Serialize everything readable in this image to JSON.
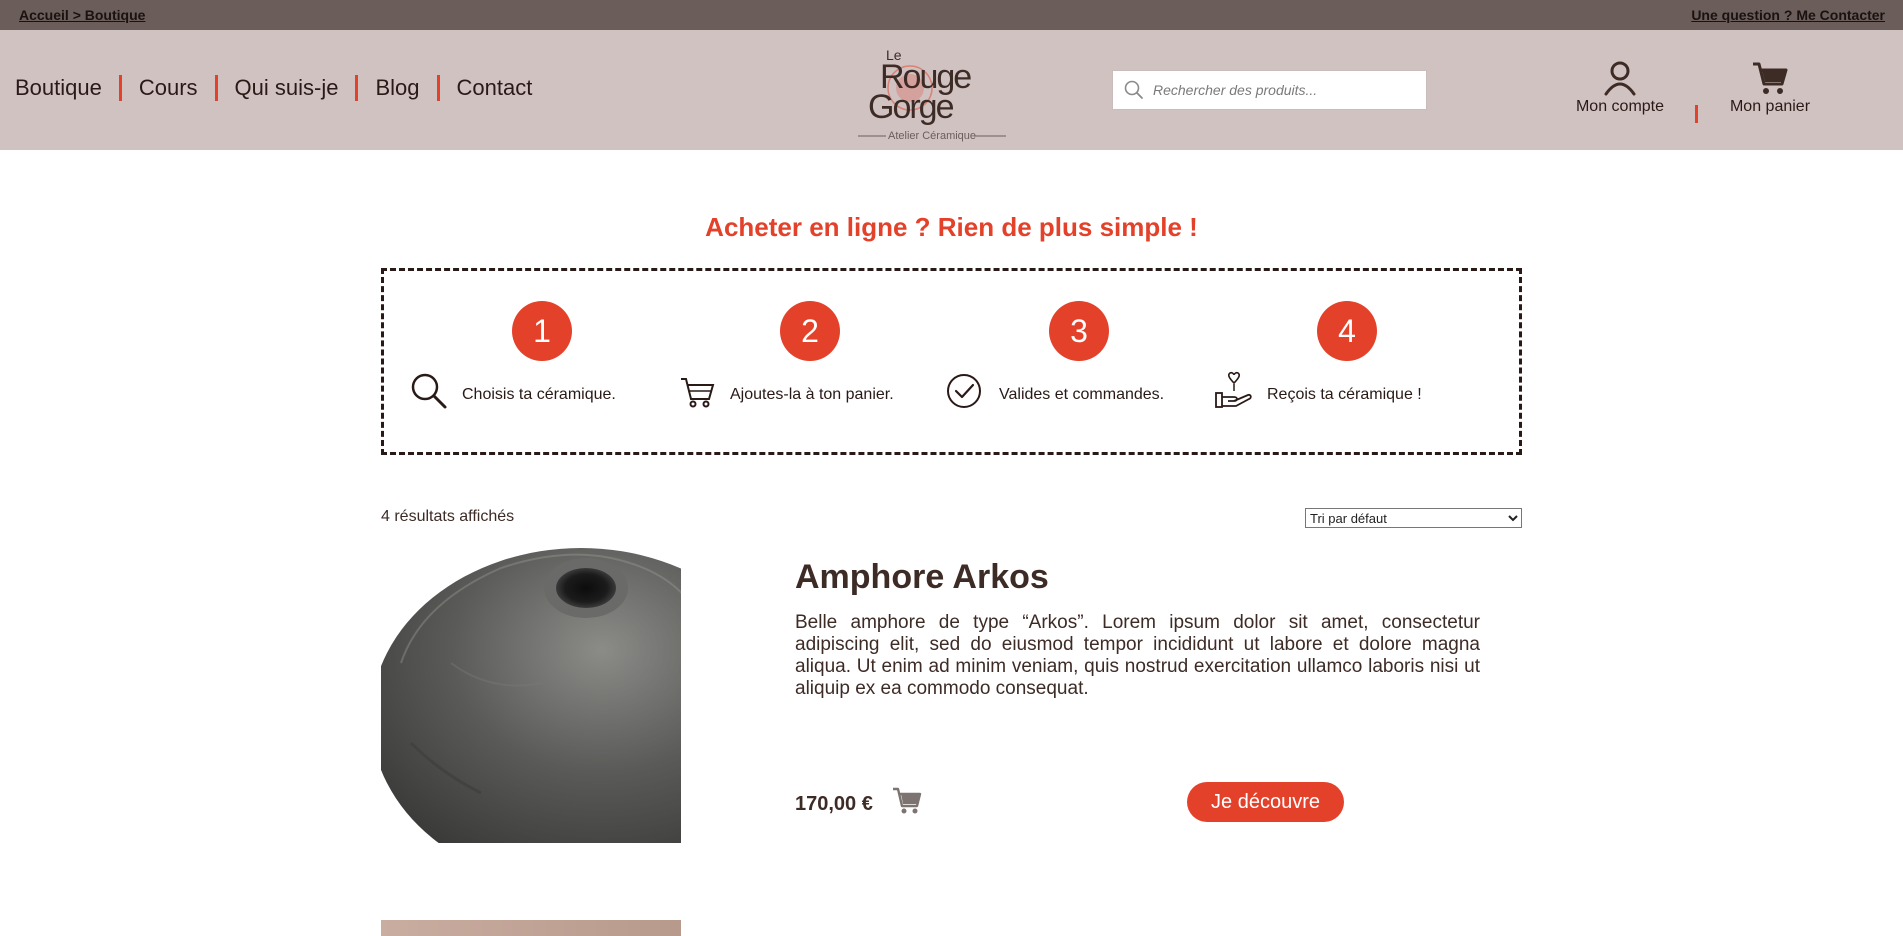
{
  "topbar": {
    "breadcrumb": "Accueil > Boutique",
    "contact": "Une question ? Me Contacter"
  },
  "nav": {
    "items": [
      "Boutique",
      "Cours",
      "Qui suis-je",
      "Blog",
      "Contact"
    ]
  },
  "logo": {
    "line1": "Le",
    "line2": "Rouge",
    "line3": "Gorge",
    "tagline": "Atelier Céramique"
  },
  "search": {
    "placeholder": "Rechercher des produits..."
  },
  "header": {
    "account_label": "Mon compte",
    "cart_label": "Mon panier"
  },
  "steps": {
    "title": "Acheter en ligne ? Rien de plus simple !",
    "items": [
      {
        "number": "1",
        "text": "Choisis ta céramique.",
        "icon": "magnifier-icon"
      },
      {
        "number": "2",
        "text": "Ajoutes-la à ton panier.",
        "icon": "cart-icon"
      },
      {
        "number": "3",
        "text": "Valides et commandes.",
        "icon": "check-circle-icon"
      },
      {
        "number": "4",
        "text": "Reçois ta céramique !",
        "icon": "hand-heart-icon"
      }
    ]
  },
  "results": {
    "count": "4 résultats affichés",
    "sort_selected": "Tri par défaut"
  },
  "product": {
    "name": "Amphore Arkos",
    "description": "Belle amphore de type “Arkos”. Lorem ipsum dolor sit amet, consectetur adipiscing elit, sed do eiusmod tempor incididunt ut labore et dolore magna aliqua. Ut enim ad minim veniam, quis nostrud exercitation ullamco laboris nisi ut aliquip ex ea commodo consequat.",
    "price": "170,00 €",
    "button": "Je découvre"
  },
  "colors": {
    "accent": "#e4412a",
    "topbar": "#6b5d5a",
    "header": "#d1c2c2",
    "text": "#3d2b26"
  }
}
